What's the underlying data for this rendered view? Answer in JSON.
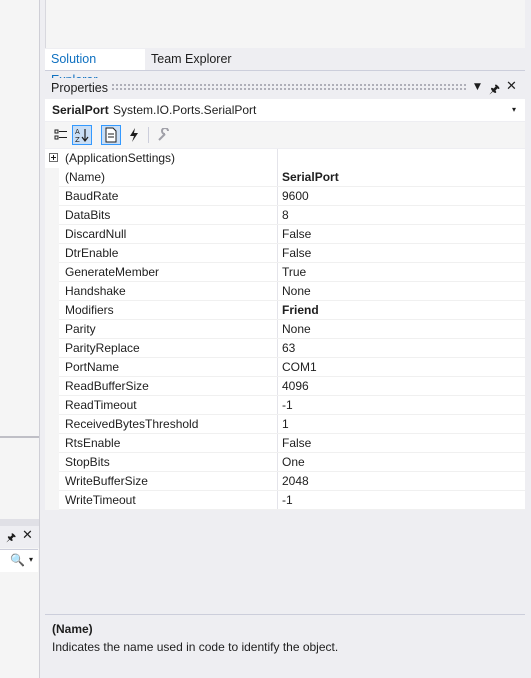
{
  "tabs": {
    "solution": "Solution Explorer",
    "team": "Team Explorer"
  },
  "properties": {
    "title": "Properties",
    "object_name": "SerialPort",
    "object_type": "System.IO.Ports.SerialPort",
    "category": "(ApplicationSettings)",
    "rows": [
      {
        "name": "(Name)",
        "value": "SerialPort",
        "bold": true
      },
      {
        "name": "BaudRate",
        "value": "9600",
        "bold": false
      },
      {
        "name": "DataBits",
        "value": "8",
        "bold": false
      },
      {
        "name": "DiscardNull",
        "value": "False",
        "bold": false
      },
      {
        "name": "DtrEnable",
        "value": "False",
        "bold": false
      },
      {
        "name": "GenerateMember",
        "value": "True",
        "bold": false
      },
      {
        "name": "Handshake",
        "value": "None",
        "bold": false
      },
      {
        "name": "Modifiers",
        "value": "Friend",
        "bold": true
      },
      {
        "name": "Parity",
        "value": "None",
        "bold": false
      },
      {
        "name": "ParityReplace",
        "value": "63",
        "bold": false
      },
      {
        "name": "PortName",
        "value": "COM1",
        "bold": false
      },
      {
        "name": "ReadBufferSize",
        "value": "4096",
        "bold": false
      },
      {
        "name": "ReadTimeout",
        "value": "-1",
        "bold": false
      },
      {
        "name": "ReceivedBytesThreshold",
        "value": "1",
        "bold": false
      },
      {
        "name": "RtsEnable",
        "value": "False",
        "bold": false
      },
      {
        "name": "StopBits",
        "value": "One",
        "bold": false
      },
      {
        "name": "WriteBufferSize",
        "value": "2048",
        "bold": false
      },
      {
        "name": "WriteTimeout",
        "value": "-1",
        "bold": false
      }
    ],
    "description": {
      "title": "(Name)",
      "text": "Indicates the name used in code to identify the object."
    }
  },
  "icons": {
    "header": [
      "dropdown-arrow-icon",
      "pin-icon",
      "close-icon"
    ],
    "toolbar": [
      "categorized-icon",
      "alphabetical-icon",
      "properties-page-icon",
      "events-icon",
      "property-pages-icon"
    ],
    "left_panel": [
      "pin-icon",
      "close-icon",
      "search-icon"
    ]
  },
  "colors": {
    "accent": "#0e70c0",
    "selection": "#c9def5",
    "selection_border": "#3399ff"
  }
}
